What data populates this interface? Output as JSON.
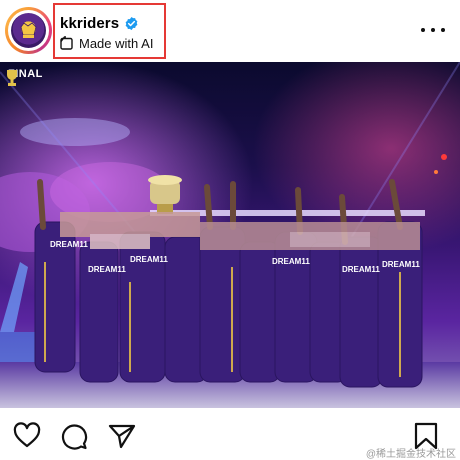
{
  "post": {
    "username": "kkriders",
    "verified": true,
    "ai_label": "Made with AI",
    "image_overlay": {
      "badge_text": "FINAL"
    },
    "jersey_text": "DREAM11"
  },
  "icons": {
    "avatar": "team-logo",
    "verified": "verified-badge-icon",
    "ai": "ai-label-icon",
    "more": "more-options-icon",
    "like": "heart-icon",
    "comment": "comment-icon",
    "share": "send-icon",
    "save": "bookmark-icon"
  },
  "colors": {
    "highlight_box": "#e53935",
    "verified_blue": "#1d9bf0",
    "team_purple": "#3a1f7a",
    "team_gold": "#f3c744"
  },
  "watermark": "@稀土掘金技术社区"
}
